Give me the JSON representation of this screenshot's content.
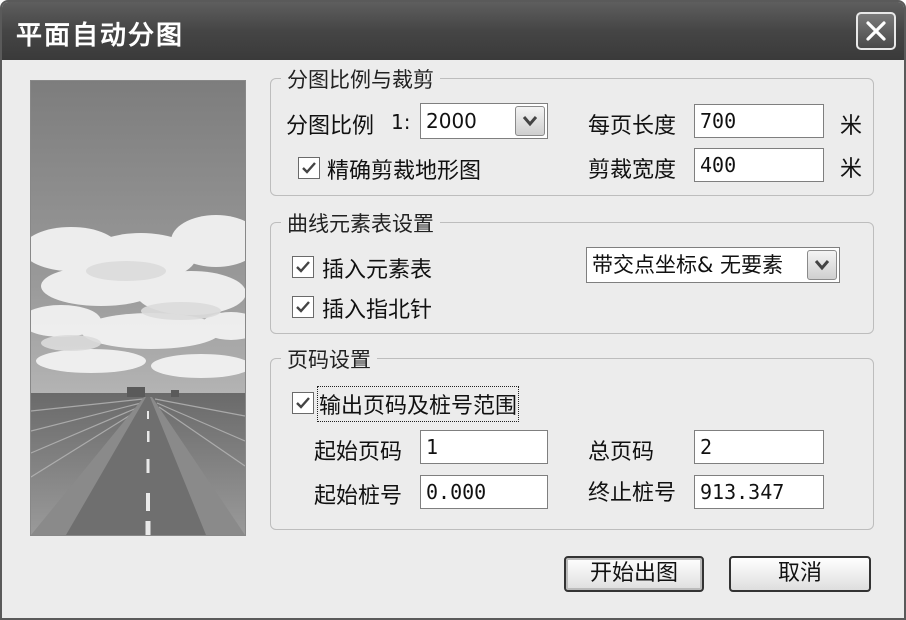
{
  "window": {
    "title": "平面自动分图"
  },
  "icons": {
    "close": "close-icon",
    "photo": "road-landscape-image",
    "dropdown": "chevron-down-icon",
    "check": "check-icon"
  },
  "colors": {
    "titlebar": "#454545",
    "dialog_bg": "#ececec",
    "accent_sky": "#8d8d8d"
  },
  "split_section": {
    "legend": "分图比例与裁剪",
    "scale_label": "分图比例",
    "scale_prefix": "1:",
    "scale_value": "2000",
    "precise_clip_label": "精确剪裁地形图",
    "precise_clip_checked": true,
    "page_length_label": "每页长度",
    "page_length_value": "700",
    "page_length_unit": "米",
    "clip_width_label": "剪裁宽度",
    "clip_width_value": "400",
    "clip_width_unit": "米"
  },
  "curve_section": {
    "legend": "曲线元素表设置",
    "insert_table_label": "插入元素表",
    "insert_table_checked": true,
    "insert_north_label": "插入指北针",
    "insert_north_checked": true,
    "table_style_value": "带交点坐标& 无要素"
  },
  "page_section": {
    "legend": "页码设置",
    "output_label": "输出页码及桩号范围",
    "output_checked": true,
    "start_page_label": "起始页码",
    "start_page_value": "1",
    "total_pages_label": "总页码",
    "total_pages_value": "2",
    "start_station_label": "起始桩号",
    "start_station_value": "0.000",
    "end_station_label": "终止桩号",
    "end_station_value": "913.347"
  },
  "buttons": {
    "start": "开始出图",
    "cancel": "取消"
  }
}
